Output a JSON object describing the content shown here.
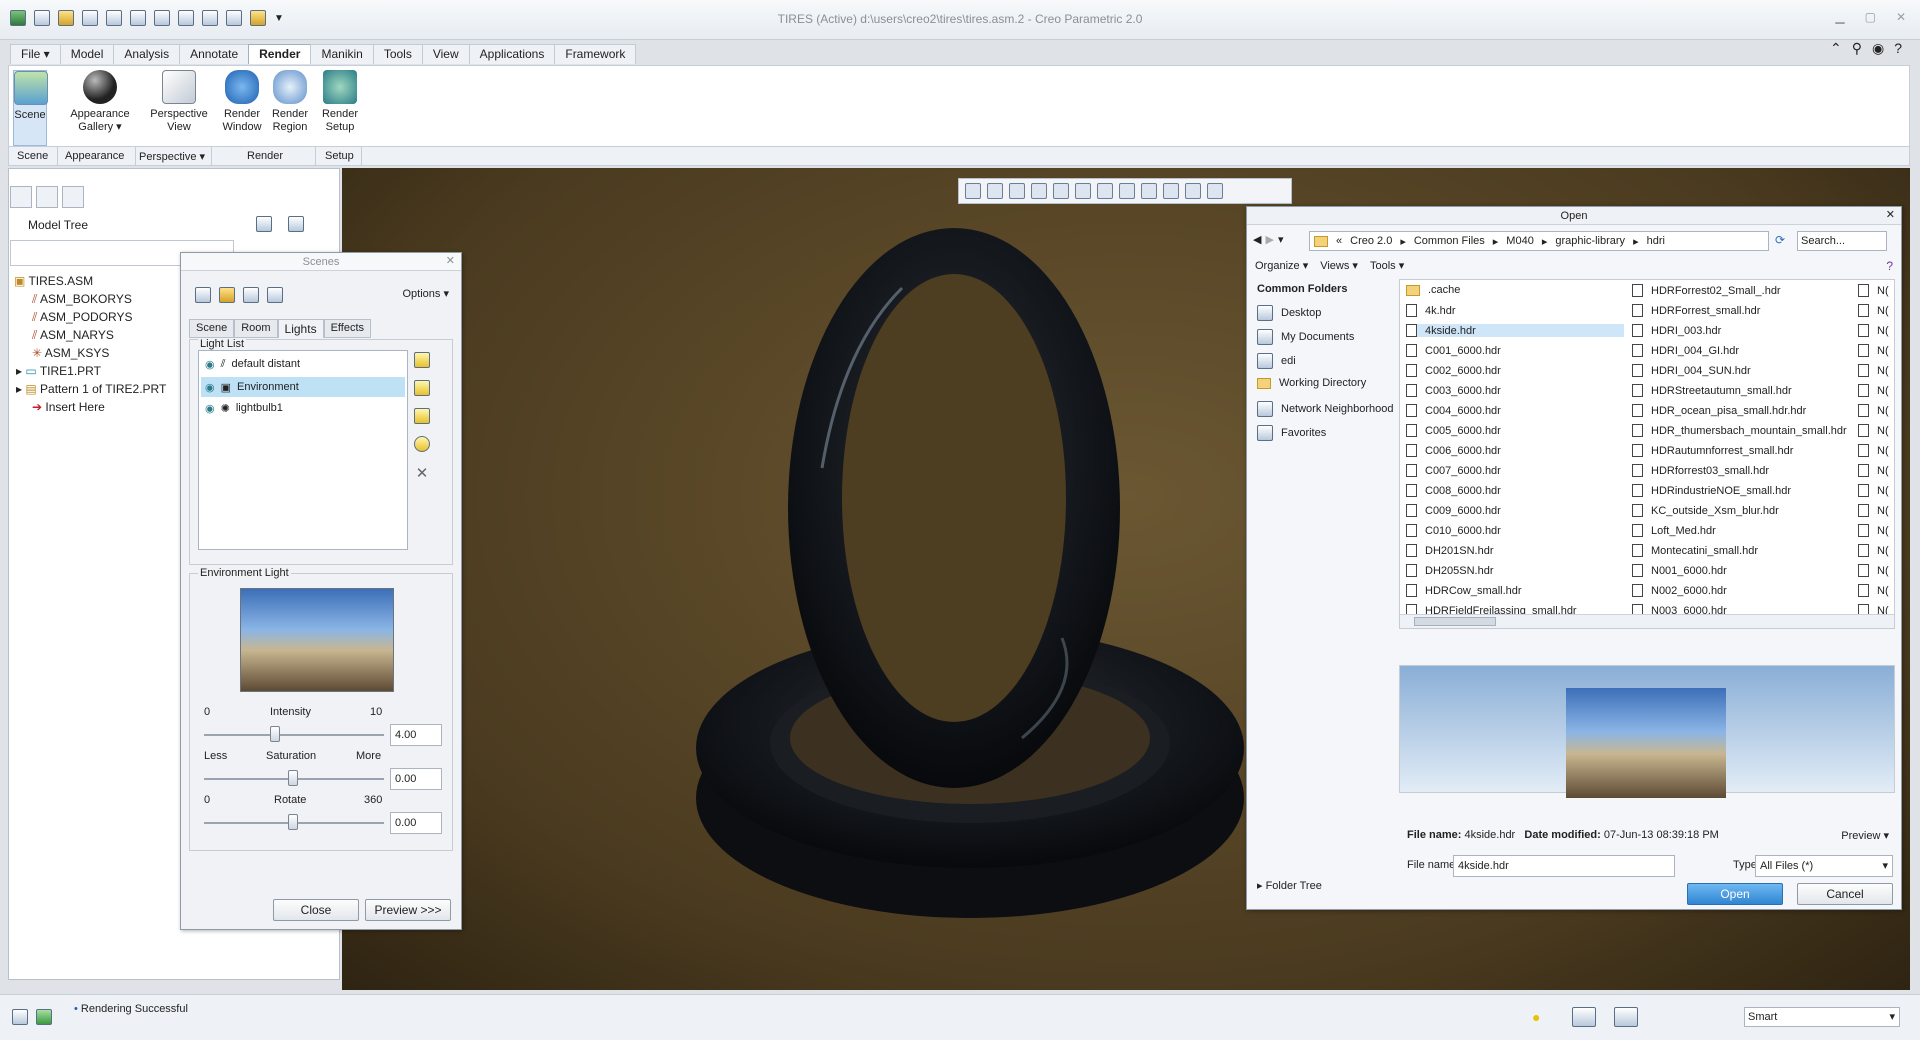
{
  "app": {
    "title": "TIRES (Active) d:\\users\\creo2\\tires\\tires.asm.2 - Creo Parametric 2.0"
  },
  "tabs": [
    "File",
    "Model",
    "Analysis",
    "Annotate",
    "Render",
    "Manikin",
    "Tools",
    "View",
    "Applications",
    "Framework"
  ],
  "ribbon": {
    "scene": "Scene",
    "appearance1": "Appearance",
    "appearance2": "Gallery",
    "perspective1": "Perspective",
    "perspective2": "View",
    "renderwin1": "Render",
    "renderwin2": "Window",
    "renderreg1": "Render",
    "renderreg2": "Region",
    "rsetup1": "Render",
    "rsetup2": "Setup"
  },
  "groups": {
    "scene": "Scene",
    "appearance": "Appearance",
    "perspective": "Perspective",
    "render": "Render",
    "setup": "Setup"
  },
  "modeltree": {
    "label": "Model Tree",
    "items": [
      "TIRES.ASM",
      "ASM_BOKORYS",
      "ASM_PODORYS",
      "ASM_NARYS",
      "ASM_KSYS",
      "TIRE1.PRT",
      "Pattern 1 of TIRE2.PRT",
      "Insert Here"
    ]
  },
  "scenes": {
    "title": "Scenes",
    "options": "Options",
    "tabs": [
      "Scene",
      "Room",
      "Lights",
      "Effects"
    ],
    "lightlist": "Light List",
    "lights": [
      "default distant",
      "Environment",
      "lightbulb1"
    ],
    "envlight": "Environment Light",
    "intensity": "Intensity",
    "int_min": "0",
    "int_max": "10",
    "int_val": "4.00",
    "saturation": "Saturation",
    "sat_min": "Less",
    "sat_max": "More",
    "sat_val": "0.00",
    "rotate": "Rotate",
    "rot_min": "0",
    "rot_max": "360",
    "rot_val": "0.00",
    "close": "Close",
    "preview": "Preview >>>"
  },
  "open": {
    "title": "Open",
    "path": [
      "Creo 2.0",
      "Common Files",
      "M040",
      "graphic-library",
      "hdri"
    ],
    "search": "Search...",
    "organize": "Organize",
    "views": "Views",
    "tools": "Tools",
    "common": "Common Folders",
    "places": [
      "Desktop",
      "My Documents",
      "edi",
      "Working Directory",
      "Network Neighborhood",
      "Favorites"
    ],
    "col1": [
      ".cache",
      "4k.hdr",
      "4kside.hdr",
      "C001_6000.hdr",
      "C002_6000.hdr",
      "C003_6000.hdr",
      "C004_6000.hdr",
      "C005_6000.hdr",
      "C006_6000.hdr",
      "C007_6000.hdr",
      "C008_6000.hdr",
      "C009_6000.hdr",
      "C010_6000.hdr",
      "DH201SN.hdr",
      "DH205SN.hdr",
      "HDRCow_small.hdr",
      "HDRFieldFreilassing_small.hdr"
    ],
    "col2": [
      "HDRForrest02_Small_.hdr",
      "HDRForrest_small.hdr",
      "HDRI_003.hdr",
      "HDRI_004_GI.hdr",
      "HDRI_004_SUN.hdr",
      "HDRStreetautumn_small.hdr",
      "HDR_ocean_pisa_small.hdr.hdr",
      "HDR_thumersbach_mountain_small.hdr",
      "HDRautumnforrest_small.hdr",
      "HDRforrest03_small.hdr",
      "HDRindustrieNOE_small.hdr",
      "KC_outside_Xsm_blur.hdr",
      "Loft_Med.hdr",
      "Montecatini_small.hdr",
      "N001_6000.hdr",
      "N002_6000.hdr",
      "N003_6000.hdr"
    ],
    "col3": "N(",
    "fileinfo_label": "File name:",
    "fileinfo_name": "4kside.hdr",
    "datemod_label": "Date modified:",
    "datemod": "07-Jun-13 08:39:18 PM",
    "preview": "Preview",
    "filename_label": "File name:",
    "filename": "4kside.hdr",
    "type_label": "Type",
    "type": "All Files (*)",
    "folder_tree": "Folder Tree",
    "open_btn": "Open",
    "cancel_btn": "Cancel"
  },
  "status": {
    "message": "Rendering Successful",
    "filter": "Smart"
  }
}
